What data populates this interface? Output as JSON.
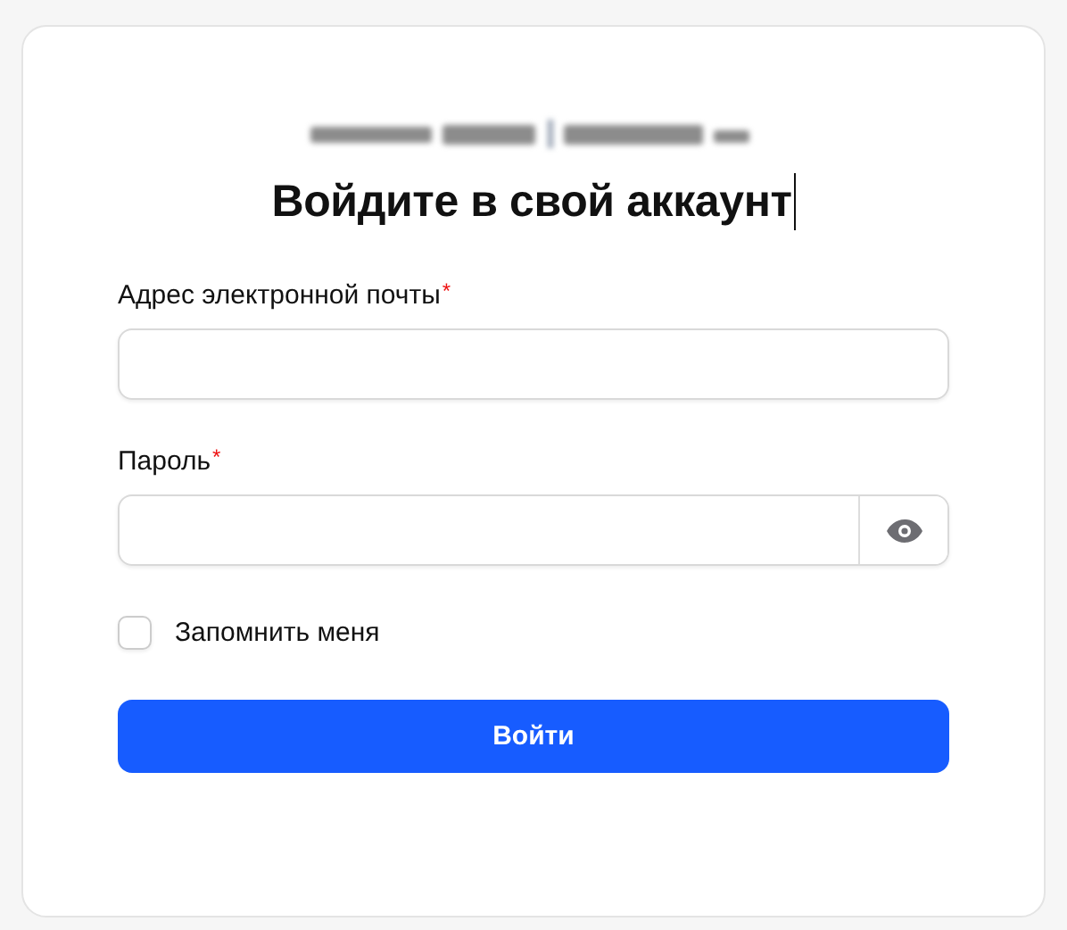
{
  "title": "Войдите в свой аккаунт",
  "fields": [
    {
      "kind": "text",
      "label": "Адрес электронной почты",
      "mark": "*"
    },
    {
      "kind": "password",
      "label": "Пароль",
      "mark": "*"
    }
  ],
  "remember": {
    "label": "Запомнить меня",
    "checked": false
  },
  "submit": {
    "label": "Войти"
  }
}
